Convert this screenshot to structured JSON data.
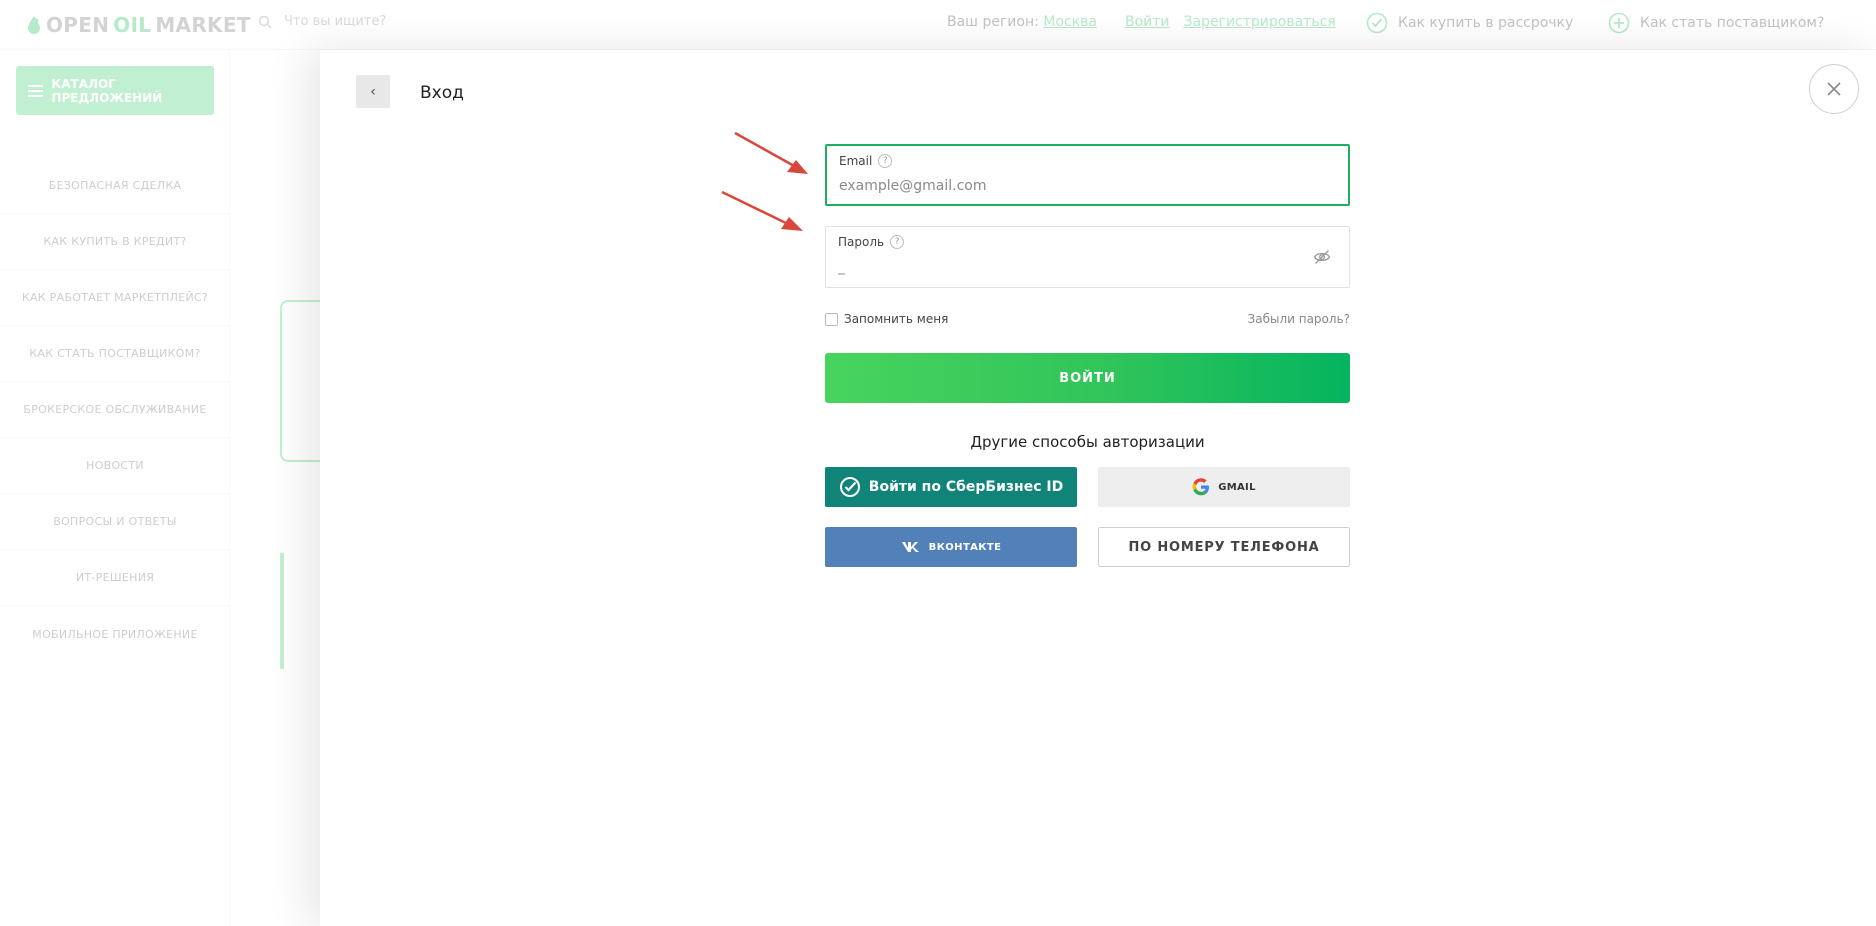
{
  "header": {
    "logo_part1": "OPEN",
    "logo_part2": "OIL",
    "logo_part3": "MARKET",
    "search_placeholder": "Что вы ищите?",
    "region_label": "Ваш регион:",
    "region_value": "Москва",
    "login_link": "Войти",
    "register_link": "Зарегистрироваться",
    "installment_link": "Как купить в рассрочку",
    "supplier_link": "Как стать поставщиком?"
  },
  "sidebar": {
    "catalog_label": "КАТАЛОГ ПРЕДЛОЖЕНИЙ",
    "items": [
      {
        "label": "БЕЗОПАСНАЯ СДЕЛКА"
      },
      {
        "label": "КАК КУПИТЬ В КРЕДИТ?"
      },
      {
        "label": "КАК РАБОТАЕТ МАРКЕТПЛЕЙС?"
      },
      {
        "label": "КАК СТАТЬ ПОСТАВЩИКОМ?"
      },
      {
        "label": "БРОКЕРСКОЕ ОБСЛУЖИВАНИЕ"
      },
      {
        "label": "НОВОСТИ"
      },
      {
        "label": "ВОПРОСЫ И ОТВЕТЫ"
      },
      {
        "label": "ИТ-РЕШЕНИЯ"
      },
      {
        "label": "МОБИЛЬНОЕ ПРИЛОЖЕНИЕ"
      }
    ]
  },
  "modal": {
    "back_glyph": "‹",
    "title": "Вход",
    "email": {
      "label": "Email",
      "help": "?",
      "placeholder": "example@gmail.com",
      "value": ""
    },
    "password": {
      "label": "Пароль",
      "help": "?",
      "value": "",
      "placeholder": "_"
    },
    "remember_label": "Запомнить меня",
    "forgot_label": "Забыли пароль?",
    "submit_label": "ВОЙТИ",
    "other_methods_title": "Другие способы авторизации",
    "sber_label": "Войти по СберБизнес ID",
    "gmail_label": "GMAIL",
    "vk_label": "ВКОНТАКТЕ",
    "phone_label": "ПО НОМЕРУ ТЕЛЕФОНА"
  },
  "colors": {
    "brand_green": "#1fbf5a",
    "focus_border": "#1fae5f",
    "sber_teal": "#108478",
    "vk_blue": "#5181b8",
    "annotation_red": "#d9473b"
  }
}
